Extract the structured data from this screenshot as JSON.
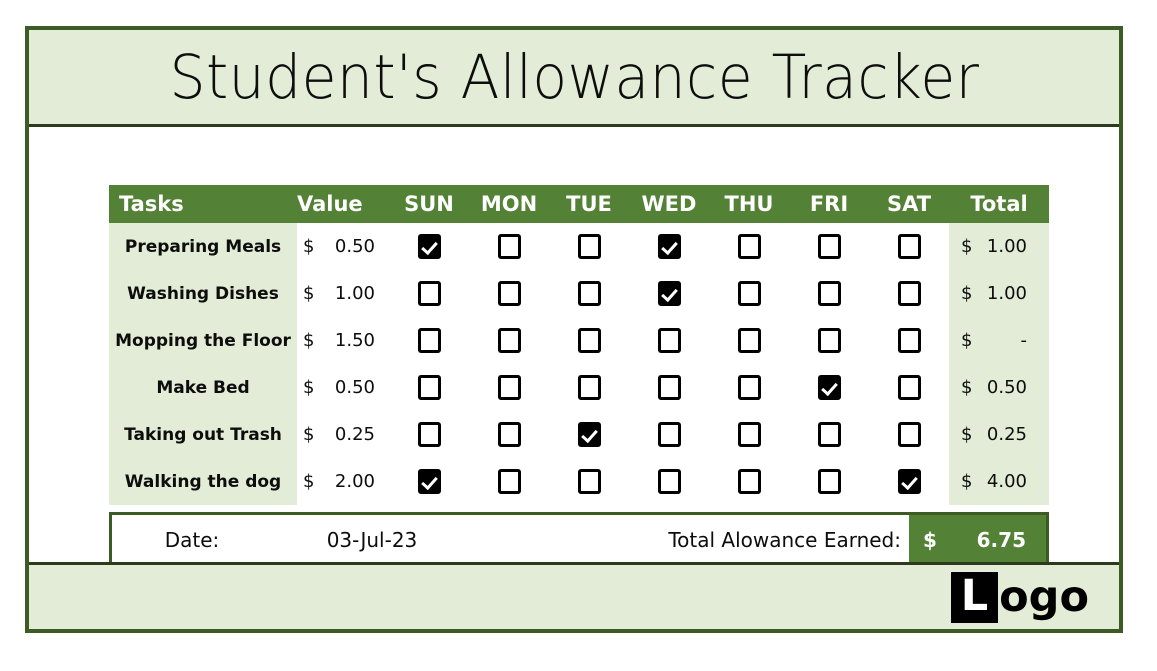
{
  "document": {
    "title": "Student's Allowance Tracker"
  },
  "colors": {
    "header_green": "#538135",
    "light_green": "#e2ecd6",
    "border_green": "#3d5b25",
    "text_black": "#0d0d0d"
  },
  "table": {
    "headers": {
      "tasks": "Tasks",
      "value": "Value",
      "total": "Total",
      "days": [
        "SUN",
        "MON",
        "TUE",
        "WED",
        "THU",
        "FRI",
        "SAT"
      ]
    },
    "currency_symbol": "$",
    "rows": [
      {
        "task": "Preparing Meals",
        "value": "0.50",
        "checks": [
          true,
          false,
          false,
          true,
          false,
          false,
          false
        ],
        "total": "1.00"
      },
      {
        "task": "Washing Dishes",
        "value": "1.00",
        "checks": [
          false,
          false,
          false,
          true,
          false,
          false,
          false
        ],
        "total": "1.00"
      },
      {
        "task": "Mopping the Floor",
        "value": "1.50",
        "checks": [
          false,
          false,
          false,
          false,
          false,
          false,
          false
        ],
        "total": "-"
      },
      {
        "task": "Make Bed",
        "value": "0.50",
        "checks": [
          false,
          false,
          false,
          false,
          false,
          true,
          false
        ],
        "total": "0.50"
      },
      {
        "task": "Taking out Trash",
        "value": "0.25",
        "checks": [
          false,
          false,
          true,
          false,
          false,
          false,
          false
        ],
        "total": "0.25"
      },
      {
        "task": "Walking the dog",
        "value": "2.00",
        "checks": [
          true,
          false,
          false,
          false,
          false,
          false,
          true
        ],
        "total": "4.00"
      }
    ]
  },
  "summary": {
    "date_label": "Date:",
    "date_value": "03-Jul-23",
    "total_label": "Total Alowance Earned:",
    "total_symbol": "$",
    "total_value": "6.75"
  },
  "logo": {
    "mark": "L",
    "rest": "ogo"
  }
}
